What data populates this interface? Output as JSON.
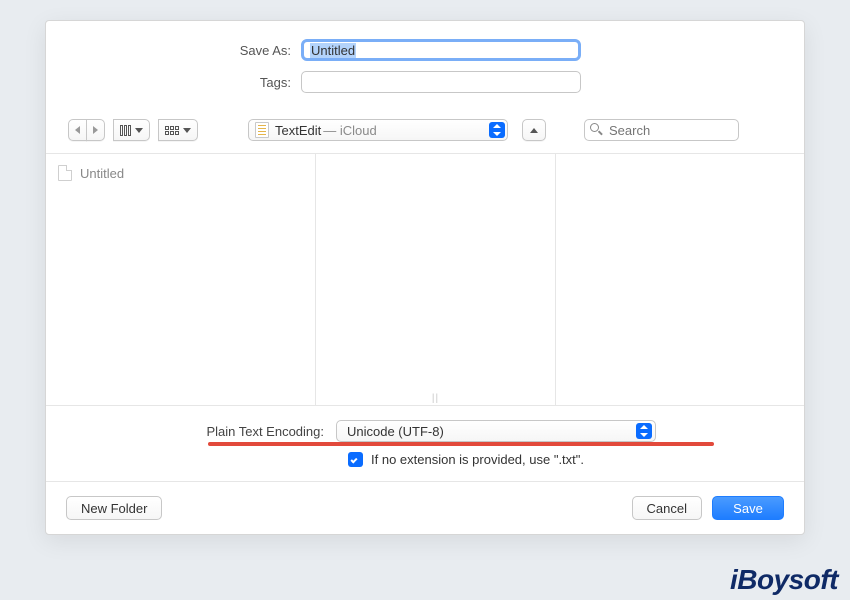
{
  "fields": {
    "save_as_label": "Save As:",
    "save_as_value": "Untitled",
    "tags_label": "Tags:",
    "tags_value": ""
  },
  "toolbar": {
    "location_primary": "TextEdit",
    "location_secondary": " — iCloud",
    "search_placeholder": "Search"
  },
  "browser": {
    "files": [
      {
        "name": "Untitled"
      }
    ]
  },
  "options": {
    "encoding_label": "Plain Text Encoding:",
    "encoding_value": "Unicode (UTF-8)",
    "ext_checkbox_label": "If no extension is provided, use \".txt\"."
  },
  "footer": {
    "new_folder": "New Folder",
    "cancel": "Cancel",
    "save": "Save"
  },
  "branding": {
    "logo": "iBoysoft"
  }
}
